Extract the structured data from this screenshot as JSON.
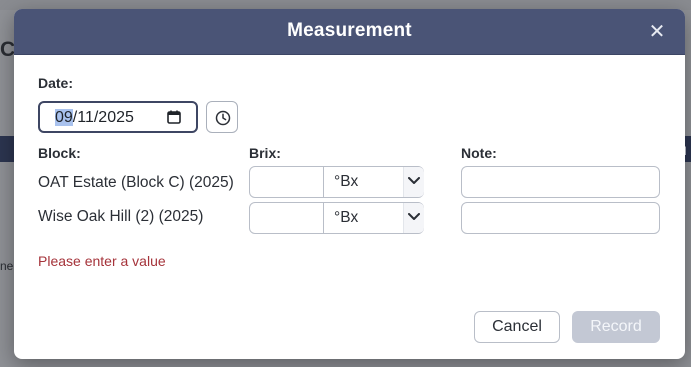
{
  "background": {
    "page_letter": "C",
    "band_text": "d",
    "side_text": "ne"
  },
  "modal": {
    "title": "Measurement",
    "close_icon": "close-icon",
    "date_label": "Date:",
    "date": {
      "month": "09",
      "rest": "/11/2025",
      "calendar_icon": "calendar-icon"
    },
    "clock_icon": "clock-icon",
    "columns": {
      "block": "Block:",
      "brix": "Brix:",
      "note": "Note:"
    },
    "rows": [
      {
        "block": "OAT Estate (Block C) (2025)",
        "brix_value": "",
        "unit": "°Bx",
        "note": ""
      },
      {
        "block": "Wise Oak Hill (2) (2025)",
        "brix_value": "",
        "unit": "°Bx",
        "note": ""
      }
    ],
    "error": "Please enter a value",
    "buttons": {
      "cancel": "Cancel",
      "record": "Record"
    }
  },
  "colors": {
    "header": "#4a5476",
    "error": "#a5333a",
    "disabled_button": "#c3c8d4",
    "focus_border": "#3e4663"
  }
}
